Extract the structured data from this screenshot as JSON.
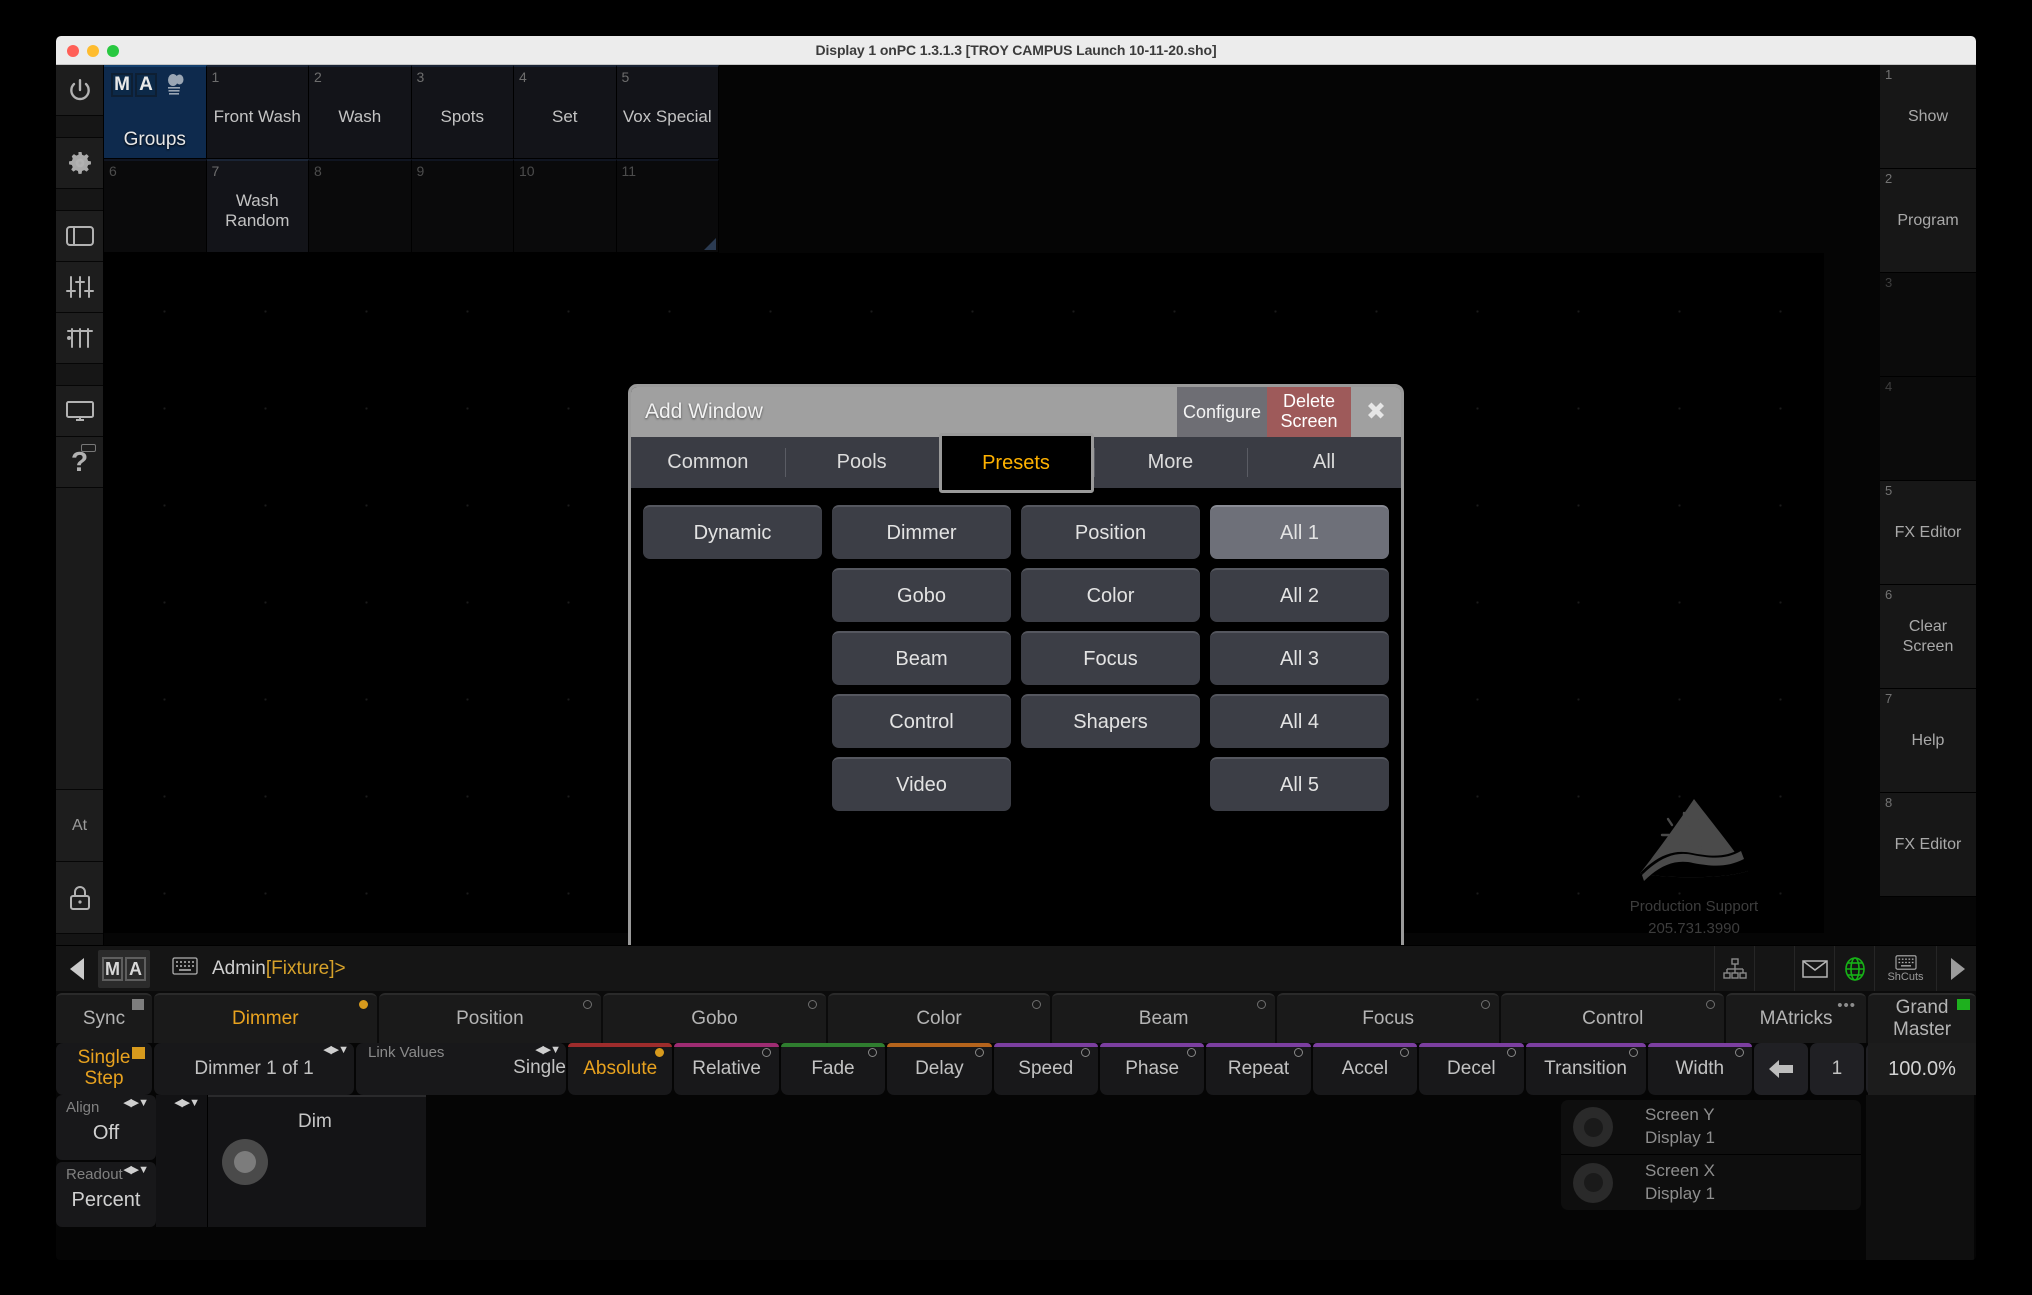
{
  "window": {
    "title": "Display 1 onPC 1.3.1.3 [TROY CAMPUS Launch 10-11-20.sho]"
  },
  "left_rail": {
    "items": [
      {
        "name": "power-icon",
        "label": ""
      },
      {
        "name": "spacer-1",
        "label": ""
      },
      {
        "name": "setup-gear-icon",
        "label": ""
      },
      {
        "name": "spacer-2",
        "label": ""
      },
      {
        "name": "window-icon",
        "label": ""
      },
      {
        "name": "faders-icon",
        "label": ""
      },
      {
        "name": "encoder-icon",
        "label": ""
      },
      {
        "name": "spacer-3",
        "label": ""
      },
      {
        "name": "monitor-icon",
        "label": ""
      },
      {
        "name": "help-question-icon",
        "label": ""
      }
    ],
    "at_label": "At",
    "lock_label": ""
  },
  "groups_pool": {
    "header": {
      "ma_left": "M",
      "ma_right": "A",
      "title": "Groups"
    },
    "cells": [
      {
        "num": "1",
        "label": "Front Wash"
      },
      {
        "num": "2",
        "label": "Wash"
      },
      {
        "num": "3",
        "label": "Spots"
      },
      {
        "num": "4",
        "label": "Set"
      },
      {
        "num": "5",
        "label": "Vox Special"
      },
      {
        "num": "6",
        "label": ""
      },
      {
        "num": "7",
        "label": "Wash Random"
      },
      {
        "num": "8",
        "label": ""
      },
      {
        "num": "9",
        "label": ""
      },
      {
        "num": "10",
        "label": ""
      },
      {
        "num": "11",
        "label": ""
      }
    ]
  },
  "watermark": {
    "line1": "Production Support",
    "line2": "205.731.3990"
  },
  "view_bar": {
    "items": [
      {
        "num": "1",
        "label": "Show"
      },
      {
        "num": "2",
        "label": "Program"
      },
      {
        "num": "3",
        "label": ""
      },
      {
        "num": "4",
        "label": ""
      },
      {
        "num": "5",
        "label": "FX Editor"
      },
      {
        "num": "6",
        "label": "Clear Screen"
      },
      {
        "num": "7",
        "label": "Help"
      },
      {
        "num": "8",
        "label": "FX Editor"
      }
    ]
  },
  "dialog": {
    "title": "Add Window",
    "configure_label": "Configure",
    "delete_label": "Delete Screen",
    "close_icon": "close-icon",
    "tabs": [
      {
        "label": "Common",
        "active": false
      },
      {
        "label": "Pools",
        "active": false
      },
      {
        "label": "Presets",
        "active": true
      },
      {
        "label": "More",
        "active": false
      },
      {
        "label": "All",
        "active": false
      }
    ],
    "columns": [
      {
        "name": "column-dynamic",
        "buttons": [
          {
            "label": "Dynamic",
            "highlighted": false
          }
        ]
      },
      {
        "name": "column-feature",
        "buttons": [
          {
            "label": "Dimmer",
            "highlighted": false
          },
          {
            "label": "Gobo",
            "highlighted": false
          },
          {
            "label": "Beam",
            "highlighted": false
          },
          {
            "label": "Control",
            "highlighted": false
          },
          {
            "label": "Video",
            "highlighted": false
          }
        ]
      },
      {
        "name": "column-feature-2",
        "buttons": [
          {
            "label": "Position",
            "highlighted": false
          },
          {
            "label": "Color",
            "highlighted": false
          },
          {
            "label": "Focus",
            "highlighted": false
          },
          {
            "label": "Shapers",
            "highlighted": false
          }
        ]
      },
      {
        "name": "column-all",
        "buttons": [
          {
            "label": "All 1",
            "highlighted": true
          },
          {
            "label": "All 2",
            "highlighted": false
          },
          {
            "label": "All 3",
            "highlighted": false
          },
          {
            "label": "All 4",
            "highlighted": false
          },
          {
            "label": "All 5",
            "highlighted": false
          }
        ]
      }
    ],
    "accent_color": "#ffb200",
    "delete_color": "#9e5a5a"
  },
  "command_line": {
    "ma_left": "M",
    "ma_right": "A",
    "user": "Admin",
    "bracket": "[Fixture]",
    "prompt": ">",
    "status_icons": [
      "network-icon",
      "mail-icon",
      "globe-icon",
      "keyboard-shortcuts-icon",
      "play-arrow-icon"
    ],
    "shortcuts_label": "ShCuts"
  },
  "preset_bar": {
    "items": [
      {
        "label": "Sync",
        "active": false,
        "marker": "square"
      },
      {
        "label": "Dimmer",
        "active": true,
        "marker": "led-on"
      },
      {
        "label": "Position",
        "active": false,
        "marker": "led"
      },
      {
        "label": "Gobo",
        "active": false,
        "marker": "led"
      },
      {
        "label": "Color",
        "active": false,
        "marker": "led"
      },
      {
        "label": "Beam",
        "active": false,
        "marker": "led"
      },
      {
        "label": "Focus",
        "active": false,
        "marker": "led"
      },
      {
        "label": "Control",
        "active": false,
        "marker": "led"
      },
      {
        "label": "MAtricks",
        "active": false,
        "marker": "dots"
      },
      {
        "label": "Grand Master",
        "active": false,
        "marker": "green"
      }
    ]
  },
  "encoder_bar": {
    "single_step": "Single Step",
    "feature_title": "Dimmer 1 of 1",
    "link_caption": "Link Values",
    "link_value": "Single",
    "functions": [
      {
        "label": "Absolute",
        "color": "#9e2c2c",
        "active": true
      },
      {
        "label": "Relative",
        "color": "#9e2c72",
        "active": false
      },
      {
        "label": "Fade",
        "color": "#2f7d2f",
        "active": false
      },
      {
        "label": "Delay",
        "color": "#b5641c",
        "active": false
      },
      {
        "label": "Speed",
        "color": "#7c3fa0",
        "active": false
      },
      {
        "label": "Phase",
        "color": "#7c3fa0",
        "active": false
      },
      {
        "label": "Repeat",
        "color": "#7c3fa0",
        "active": false
      },
      {
        "label": "Accel",
        "color": "#7c3fa0",
        "active": false
      },
      {
        "label": "Decel",
        "color": "#7c3fa0",
        "active": false
      },
      {
        "label": "Transition",
        "color": "#7c3fa0",
        "active": false
      },
      {
        "label": "Width",
        "color": "#7c3fa0",
        "active": false
      }
    ],
    "page_number": "1",
    "grand_master_value": "100.0%"
  },
  "bottom_encoders": {
    "align_caption": "Align",
    "align_value": "Off",
    "readout_caption": "Readout",
    "readout_value": "Percent",
    "wheel_label": "Dim",
    "screen_rows": [
      {
        "title": "Screen Y",
        "value": "Display 1"
      },
      {
        "title": "Screen X",
        "value": "Display 1"
      }
    ]
  }
}
